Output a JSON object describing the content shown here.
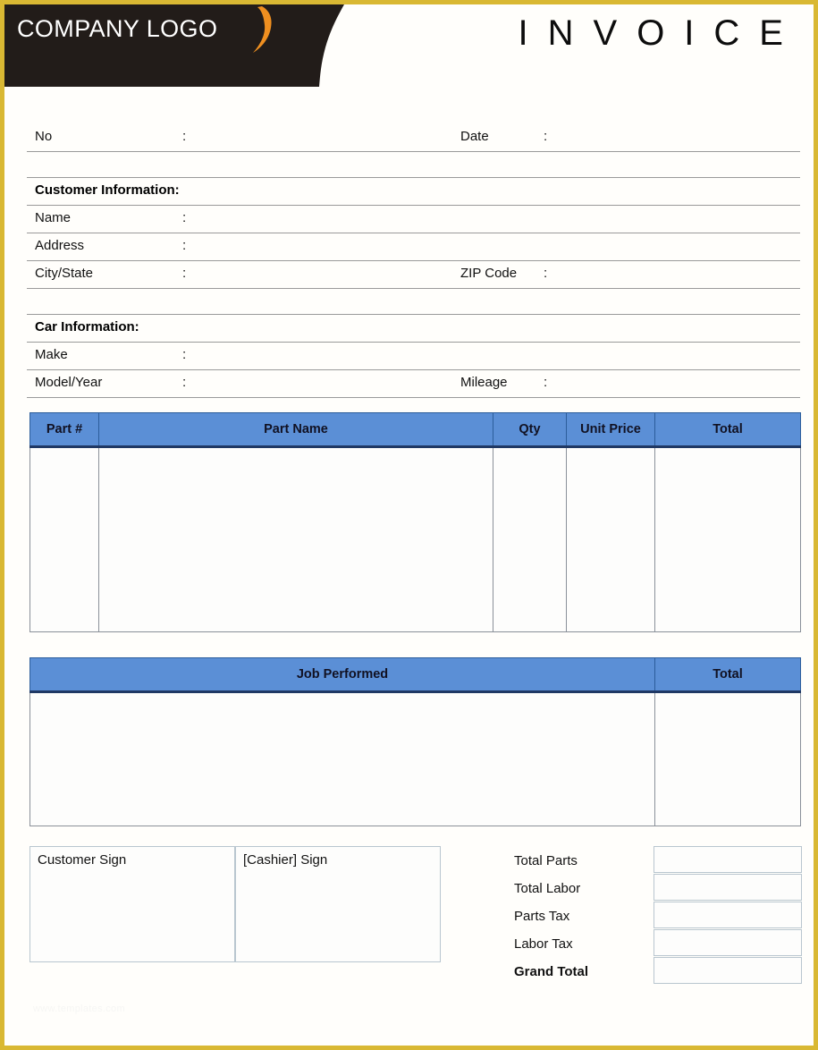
{
  "header": {
    "logo_text": "COMPANY LOGO",
    "title": "INVOICE",
    "banner_color": "#221c19",
    "swoosh_color": "#ef8f20",
    "border_color": "#d9b833"
  },
  "meta": {
    "no_label": "No",
    "no_colon": ":",
    "date_label": "Date",
    "date_colon": ":",
    "no_value": "",
    "date_value": ""
  },
  "customer": {
    "section_title": "Customer Information:",
    "rows": [
      {
        "label": "Name",
        "colon": ":",
        "value": ""
      },
      {
        "label": "Address",
        "colon": ":",
        "value": ""
      },
      {
        "label": "City/State",
        "colon": ":",
        "value": "",
        "label2": "ZIP Code",
        "colon2": ":",
        "value2": ""
      }
    ]
  },
  "car": {
    "section_title": "Car Information:",
    "rows": [
      {
        "label": "Make",
        "colon": ":",
        "value": ""
      },
      {
        "label": "Model/Year",
        "colon": ":",
        "value": "",
        "label2": "Mileage",
        "colon2": ":",
        "value2": ""
      }
    ]
  },
  "parts_table": {
    "columns": [
      "Part #",
      "Part Name",
      "Qty",
      "Unit Price",
      "Total"
    ],
    "rows": [],
    "header_bg": "#5b8fd6"
  },
  "job_table": {
    "columns": [
      "Job Performed",
      "Total"
    ],
    "rows": [],
    "header_bg": "#5b8fd6"
  },
  "signatures": {
    "customer_label": "Customer Sign",
    "cashier_label": "[Cashier] Sign"
  },
  "totals": {
    "rows": [
      {
        "label": "Total Parts",
        "value": "",
        "bold": false
      },
      {
        "label": "Total Labor",
        "value": "",
        "bold": false
      },
      {
        "label": "Parts Tax",
        "value": "",
        "bold": false
      },
      {
        "label": "Labor Tax",
        "value": "",
        "bold": false
      },
      {
        "label": "Grand Total",
        "value": "",
        "bold": true
      }
    ]
  },
  "watermark": {
    "text": "www.templates.com"
  }
}
